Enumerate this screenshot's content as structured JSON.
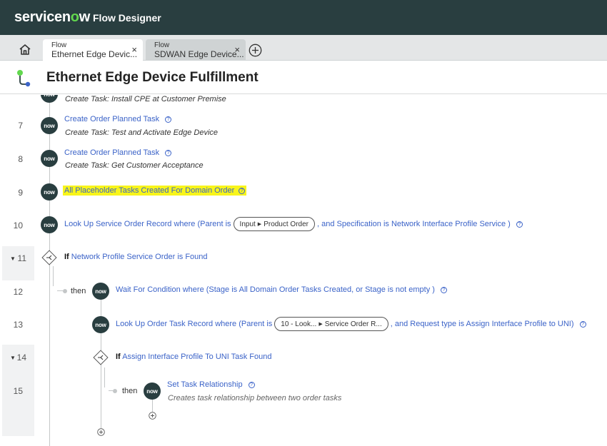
{
  "app": {
    "brand_prefix": "servicen",
    "brand_o": "o",
    "brand_suffix": "w",
    "title": "Flow Designer"
  },
  "tabs": [
    {
      "type": "Flow",
      "label": "Ethernet Edge Devic...",
      "close": "×"
    },
    {
      "type": "Flow",
      "label": "SDWAN Edge Device...",
      "close": "×"
    }
  ],
  "flow": {
    "title": "Ethernet Edge Device Fulfillment"
  },
  "icons": {
    "now": "now",
    "info": "?"
  },
  "steps": {
    "s6": {
      "desc": "Create Task: Install CPE at Customer Premise"
    },
    "s7": {
      "num": "7",
      "title": "Create Order Planned Task",
      "desc": "Create Task: Test and Activate Edge Device"
    },
    "s8": {
      "num": "8",
      "title": "Create Order Planned Task",
      "desc": "Create Task: Get Customer Acceptance"
    },
    "s9": {
      "num": "9",
      "title": "All Placeholder Tasks Created For Domain Order"
    },
    "s10": {
      "num": "10",
      "prefix": "Look Up Service Order Record where (Parent is",
      "pill_a": "Input",
      "pill_b": "Product Order",
      "suffix": ", and Specification is Network Interface Profile Service )"
    },
    "s11": {
      "num": "11",
      "keyword": "If",
      "condition": "Network Profile Service Order is Found"
    },
    "s12": {
      "num": "12",
      "then": "then",
      "title": "Wait For Condition where (Stage is All Domain Order Tasks Created, or Stage is not empty )"
    },
    "s13": {
      "num": "13",
      "prefix": "Look Up Order Task Record where (Parent is",
      "pill_a": "10 - Look...",
      "pill_b": "Service Order R...",
      "suffix": ", and Request type is Assign Interface Profile to UNI)"
    },
    "s14": {
      "num": "14",
      "keyword": "If",
      "condition": "Assign Interface Profile To UNI Task Found"
    },
    "s15": {
      "num": "15",
      "then": "then",
      "title": "Set Task Relationship",
      "desc": "Creates task relationship between two order tasks"
    }
  },
  "colors": {
    "header": "#293e40",
    "accent_green": "#62d84e",
    "link_blue": "#3b63c8",
    "highlight": "#f8f51a"
  }
}
